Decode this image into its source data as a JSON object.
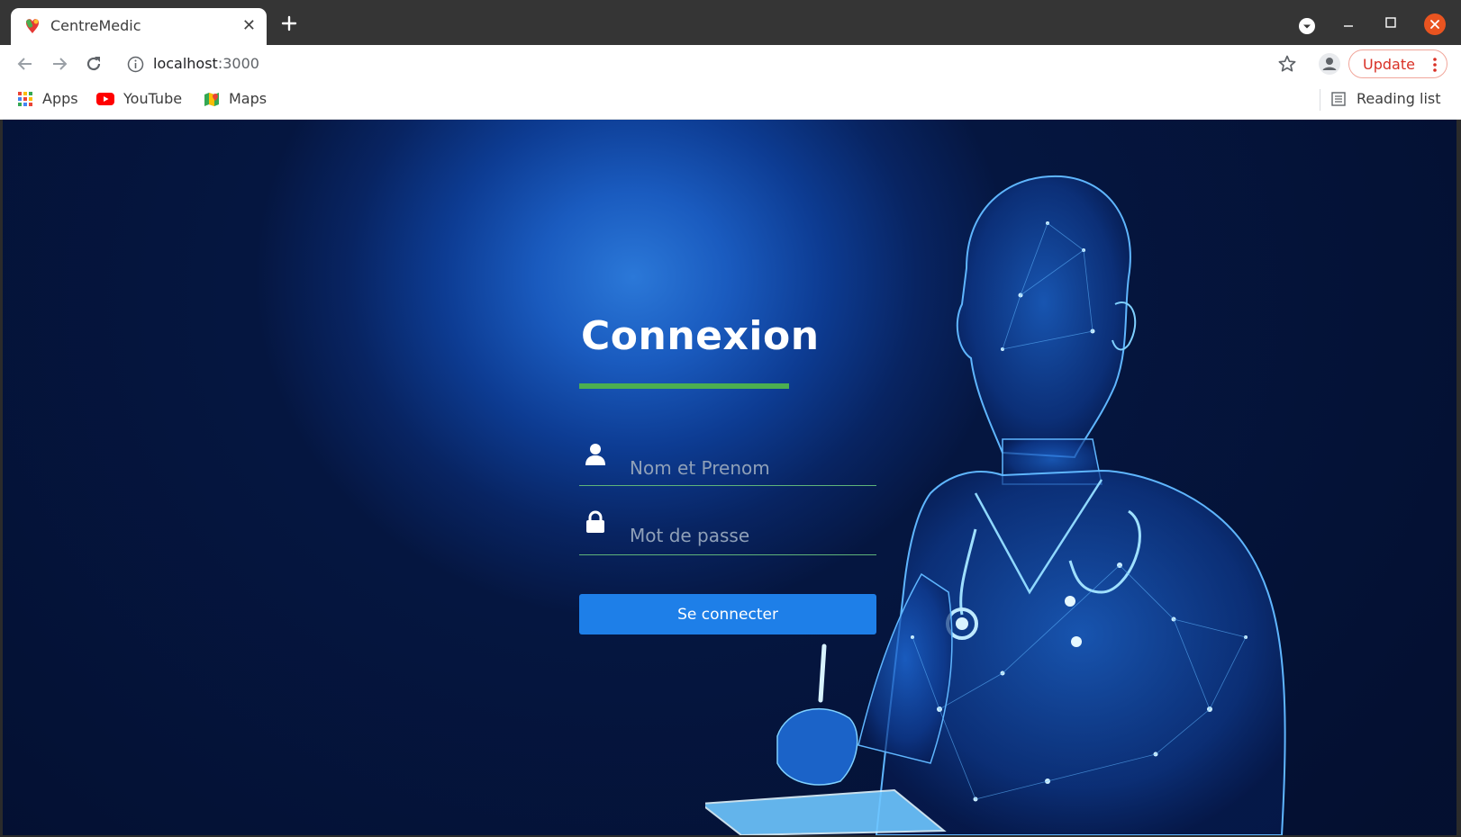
{
  "browser": {
    "tab_title": "CentreMedic",
    "tab_close": "✕",
    "url_host": "localhost",
    "url_port": ":3000",
    "update_label": "Update",
    "bookmarks": [
      {
        "label": "Apps",
        "icon": "apps-grid-icon"
      },
      {
        "label": "YouTube",
        "icon": "youtube-icon"
      },
      {
        "label": "Maps",
        "icon": "maps-icon"
      }
    ],
    "reading_list_label": "Reading list"
  },
  "login": {
    "title": "Connexion",
    "username_placeholder": "Nom et Prenom",
    "username_value": "",
    "password_placeholder": "Mot de passe",
    "password_value": "",
    "submit_label": "Se connecter"
  },
  "colors": {
    "accent_underline": "#4caf50",
    "button": "#1e7fe8",
    "background_blue": "#0d3c93",
    "update_text": "#d93025"
  }
}
